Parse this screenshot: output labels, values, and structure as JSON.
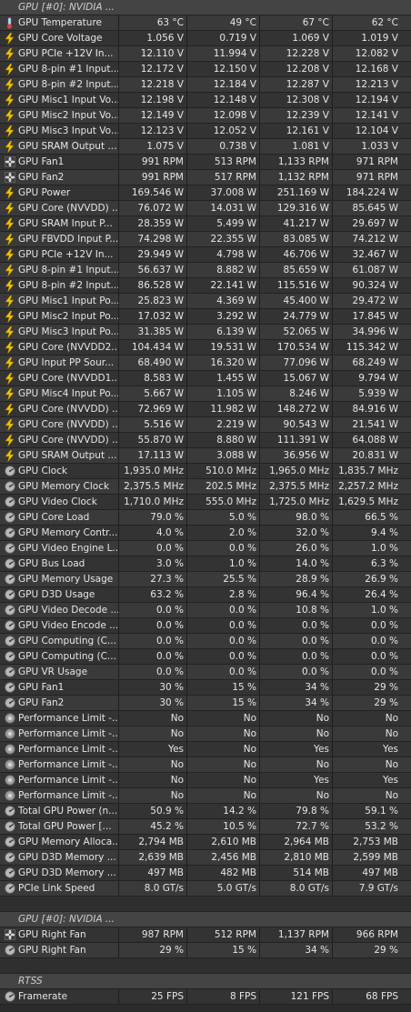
{
  "sections": [
    {
      "title": "GPU [#0]: NVIDIA ...",
      "rows": [
        {
          "icon": "thermometer-icon",
          "label": "GPU Temperature",
          "values": [
            "63 °C",
            "49 °C",
            "67 °C",
            "62 °C"
          ]
        },
        {
          "icon": "lightning-icon",
          "label": "GPU Core Voltage",
          "values": [
            "1.056 V",
            "0.719 V",
            "1.069 V",
            "1.019 V"
          ]
        },
        {
          "icon": "lightning-icon",
          "label": "GPU PCIe +12V In...",
          "values": [
            "12.110 V",
            "11.994 V",
            "12.228 V",
            "12.082 V"
          ]
        },
        {
          "icon": "lightning-icon",
          "label": "GPU 8-pin #1 Input...",
          "values": [
            "12.172 V",
            "12.150 V",
            "12.208 V",
            "12.168 V"
          ]
        },
        {
          "icon": "lightning-icon",
          "label": "GPU 8-pin #2 Input...",
          "values": [
            "12.218 V",
            "12.184 V",
            "12.287 V",
            "12.213 V"
          ]
        },
        {
          "icon": "lightning-icon",
          "label": "GPU Misc1 Input Vo...",
          "values": [
            "12.198 V",
            "12.148 V",
            "12.308 V",
            "12.194 V"
          ]
        },
        {
          "icon": "lightning-icon",
          "label": "GPU Misc2 Input Vo...",
          "values": [
            "12.149 V",
            "12.098 V",
            "12.239 V",
            "12.141 V"
          ]
        },
        {
          "icon": "lightning-icon",
          "label": "GPU Misc3 Input Vo...",
          "values": [
            "12.123 V",
            "12.052 V",
            "12.161 V",
            "12.104 V"
          ]
        },
        {
          "icon": "lightning-icon",
          "label": "GPU SRAM Output ...",
          "values": [
            "1.075 V",
            "0.738 V",
            "1.081 V",
            "1.033 V"
          ]
        },
        {
          "icon": "fan-icon",
          "label": "GPU Fan1",
          "values": [
            "991 RPM",
            "513 RPM",
            "1,133 RPM",
            "971 RPM"
          ]
        },
        {
          "icon": "fan-icon",
          "label": "GPU Fan2",
          "values": [
            "991 RPM",
            "517 RPM",
            "1,132 RPM",
            "971 RPM"
          ]
        },
        {
          "icon": "lightning-icon",
          "label": "GPU Power",
          "values": [
            "169.546 W",
            "37.008 W",
            "251.169 W",
            "184.224 W"
          ]
        },
        {
          "icon": "lightning-icon",
          "label": "GPU Core (NVVDD) ...",
          "values": [
            "76.072 W",
            "14.031 W",
            "129.316 W",
            "85.645 W"
          ]
        },
        {
          "icon": "lightning-icon",
          "label": "GPU SRAM Input P...",
          "values": [
            "28.359 W",
            "5.499 W",
            "41.217 W",
            "29.697 W"
          ]
        },
        {
          "icon": "lightning-icon",
          "label": "GPU FBVDD Input P...",
          "values": [
            "74.298 W",
            "22.355 W",
            "83.085 W",
            "74.212 W"
          ]
        },
        {
          "icon": "lightning-icon",
          "label": "GPU PCIe +12V In...",
          "values": [
            "29.949 W",
            "4.798 W",
            "46.706 W",
            "32.467 W"
          ]
        },
        {
          "icon": "lightning-icon",
          "label": "GPU 8-pin #1 Input...",
          "values": [
            "56.637 W",
            "8.882 W",
            "85.659 W",
            "61.087 W"
          ]
        },
        {
          "icon": "lightning-icon",
          "label": "GPU 8-pin #2 Input...",
          "values": [
            "86.528 W",
            "22.141 W",
            "115.516 W",
            "90.324 W"
          ]
        },
        {
          "icon": "lightning-icon",
          "label": "GPU Misc1 Input Po...",
          "values": [
            "25.823 W",
            "4.369 W",
            "45.400 W",
            "29.472 W"
          ]
        },
        {
          "icon": "lightning-icon",
          "label": "GPU Misc2 Input Po...",
          "values": [
            "17.032 W",
            "3.292 W",
            "24.779 W",
            "17.845 W"
          ]
        },
        {
          "icon": "lightning-icon",
          "label": "GPU Misc3 Input Po...",
          "values": [
            "31.385 W",
            "6.139 W",
            "52.065 W",
            "34.996 W"
          ]
        },
        {
          "icon": "lightning-icon",
          "label": "GPU Core (NVVDD2...",
          "values": [
            "104.434 W",
            "19.531 W",
            "170.534 W",
            "115.342 W"
          ]
        },
        {
          "icon": "lightning-icon",
          "label": "GPU Input PP Sour...",
          "values": [
            "68.490 W",
            "16.320 W",
            "77.096 W",
            "68.249 W"
          ]
        },
        {
          "icon": "lightning-icon",
          "label": "GPU Core (NVVDD1...",
          "values": [
            "8.583 W",
            "1.455 W",
            "15.067 W",
            "9.794 W"
          ]
        },
        {
          "icon": "lightning-icon",
          "label": "GPU Misc4 Input Po...",
          "values": [
            "5.667 W",
            "1.105 W",
            "8.246 W",
            "5.939 W"
          ]
        },
        {
          "icon": "lightning-icon",
          "label": "GPU Core (NVVDD) ...",
          "values": [
            "72.969 W",
            "11.982 W",
            "148.272 W",
            "84.916 W"
          ]
        },
        {
          "icon": "lightning-icon",
          "label": "GPU Core (NVVDD) ...",
          "values": [
            "5.516 W",
            "2.219 W",
            "90.543 W",
            "21.541 W"
          ]
        },
        {
          "icon": "lightning-icon",
          "label": "GPU Core (NVVDD) ...",
          "values": [
            "55.870 W",
            "8.880 W",
            "111.391 W",
            "64.088 W"
          ]
        },
        {
          "icon": "lightning-icon",
          "label": "GPU SRAM Output ...",
          "values": [
            "17.113 W",
            "3.088 W",
            "36.956 W",
            "20.831 W"
          ]
        },
        {
          "icon": "clock-icon",
          "label": "GPU Clock",
          "values": [
            "1,935.0 MHz",
            "510.0 MHz",
            "1,965.0 MHz",
            "1,835.7 MHz"
          ]
        },
        {
          "icon": "clock-icon",
          "label": "GPU Memory Clock",
          "values": [
            "2,375.5 MHz",
            "202.5 MHz",
            "2,375.5 MHz",
            "2,257.2 MHz"
          ]
        },
        {
          "icon": "clock-icon",
          "label": "GPU Video Clock",
          "values": [
            "1,710.0 MHz",
            "555.0 MHz",
            "1,725.0 MHz",
            "1,629.5 MHz"
          ]
        },
        {
          "icon": "gauge-icon",
          "label": "GPU Core Load",
          "values": [
            "79.0 %",
            "5.0 %",
            "98.0 %",
            "66.5 %"
          ]
        },
        {
          "icon": "gauge-icon",
          "label": "GPU Memory Contr...",
          "values": [
            "4.0 %",
            "2.0 %",
            "32.0 %",
            "9.4 %"
          ]
        },
        {
          "icon": "gauge-icon",
          "label": "GPU Video Engine L...",
          "values": [
            "0.0 %",
            "0.0 %",
            "26.0 %",
            "1.0 %"
          ]
        },
        {
          "icon": "gauge-icon",
          "label": "GPU Bus Load",
          "values": [
            "3.0 %",
            "1.0 %",
            "14.0 %",
            "6.3 %"
          ]
        },
        {
          "icon": "gauge-icon",
          "label": "GPU Memory Usage",
          "values": [
            "27.3 %",
            "25.5 %",
            "28.9 %",
            "26.9 %"
          ]
        },
        {
          "icon": "gauge-icon",
          "label": "GPU D3D Usage",
          "values": [
            "63.2 %",
            "2.8 %",
            "96.4 %",
            "26.4 %"
          ]
        },
        {
          "icon": "gauge-icon",
          "label": "GPU Video Decode ...",
          "values": [
            "0.0 %",
            "0.0 %",
            "10.8 %",
            "1.0 %"
          ]
        },
        {
          "icon": "gauge-icon",
          "label": "GPU Video Encode ...",
          "values": [
            "0.0 %",
            "0.0 %",
            "0.0 %",
            "0.0 %"
          ]
        },
        {
          "icon": "gauge-icon",
          "label": "GPU Computing (C...",
          "values": [
            "0.0 %",
            "0.0 %",
            "0.0 %",
            "0.0 %"
          ]
        },
        {
          "icon": "gauge-icon",
          "label": "GPU Computing (C...",
          "values": [
            "0.0 %",
            "0.0 %",
            "0.0 %",
            "0.0 %"
          ]
        },
        {
          "icon": "gauge-icon",
          "label": "GPU VR Usage",
          "values": [
            "0.0 %",
            "0.0 %",
            "0.0 %",
            "0.0 %"
          ]
        },
        {
          "icon": "gauge-icon",
          "label": "GPU Fan1",
          "values": [
            "30 %",
            "15 %",
            "34 %",
            "29 %"
          ]
        },
        {
          "icon": "gauge-icon",
          "label": "GPU Fan2",
          "values": [
            "30 %",
            "15 %",
            "34 %",
            "29 %"
          ]
        },
        {
          "icon": "status-dot-icon",
          "label": "Performance Limit -...",
          "values": [
            "No",
            "No",
            "No",
            "No"
          ]
        },
        {
          "icon": "status-dot-icon",
          "label": "Performance Limit -...",
          "values": [
            "No",
            "No",
            "No",
            "No"
          ]
        },
        {
          "icon": "status-dot-icon",
          "label": "Performance Limit -...",
          "values": [
            "Yes",
            "No",
            "Yes",
            "Yes"
          ]
        },
        {
          "icon": "status-dot-icon",
          "label": "Performance Limit -...",
          "values": [
            "No",
            "No",
            "No",
            "No"
          ]
        },
        {
          "icon": "status-dot-icon",
          "label": "Performance Limit -...",
          "values": [
            "No",
            "No",
            "Yes",
            "Yes"
          ]
        },
        {
          "icon": "status-dot-icon",
          "label": "Performance Limit -...",
          "values": [
            "No",
            "No",
            "No",
            "No"
          ]
        },
        {
          "icon": "gauge-icon",
          "label": "Total GPU Power (n...",
          "values": [
            "50.9 %",
            "14.2 %",
            "79.8 %",
            "59.1 %"
          ]
        },
        {
          "icon": "gauge-icon",
          "label": "Total GPU Power [...",
          "values": [
            "45.2 %",
            "10.5 %",
            "72.7 %",
            "53.2 %"
          ]
        },
        {
          "icon": "gauge-icon",
          "label": "GPU Memory Alloca...",
          "values": [
            "2,794 MB",
            "2,610 MB",
            "2,964 MB",
            "2,753 MB"
          ]
        },
        {
          "icon": "gauge-icon",
          "label": "GPU D3D Memory ...",
          "values": [
            "2,639 MB",
            "2,456 MB",
            "2,810 MB",
            "2,599 MB"
          ]
        },
        {
          "icon": "gauge-icon",
          "label": "GPU D3D Memory ...",
          "values": [
            "497 MB",
            "482 MB",
            "514 MB",
            "497 MB"
          ]
        },
        {
          "icon": "gauge-icon",
          "label": "PCIe Link Speed",
          "values": [
            "8.0 GT/s",
            "5.0 GT/s",
            "8.0 GT/s",
            "7.9 GT/s"
          ]
        }
      ]
    },
    {
      "title": "GPU [#0]: NVIDIA ...",
      "rows": [
        {
          "icon": "fan-icon",
          "label": "GPU Right Fan",
          "values": [
            "987 RPM",
            "512 RPM",
            "1,137 RPM",
            "966 RPM"
          ]
        },
        {
          "icon": "gauge-icon",
          "label": "GPU Right Fan",
          "values": [
            "29 %",
            "15 %",
            "34 %",
            "29 %"
          ]
        }
      ]
    },
    {
      "title": "RTSS",
      "rows": [
        {
          "icon": "gauge-icon",
          "label": "Framerate",
          "values": [
            "25 FPS",
            "8 FPS",
            "121 FPS",
            "68 FPS"
          ]
        }
      ]
    }
  ],
  "colors": {
    "lightning": "#f2c200",
    "thermometer_bulb": "#e04040",
    "thermometer_tube": "#d0d8f0",
    "gauge": "#b8b8b8",
    "fan": "#d8d8d8"
  }
}
